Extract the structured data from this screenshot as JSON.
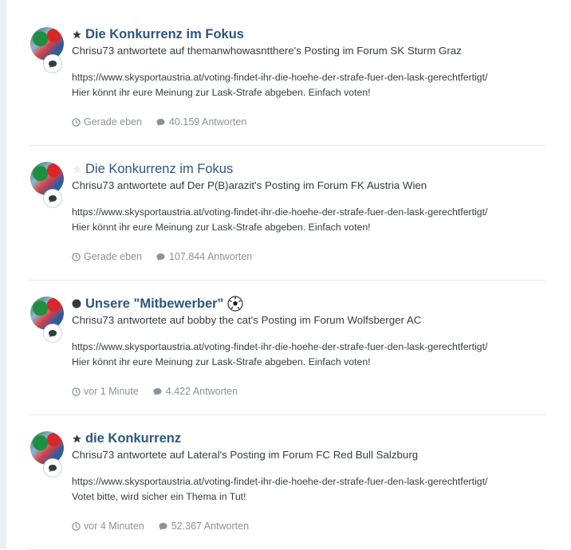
{
  "snippet_line1": "https://www.skysportaustria.at/voting-findet-ihr-die-hoehe-der-strafe-fuer-den-lask-gerechtfertigt/",
  "items": [
    {
      "title": "Die Konkurrenz im Fokus",
      "icon": "star-icon",
      "subline": "Chrisu73 antwortete auf themanwhowasntthere's Posting im Forum SK Sturm Graz",
      "snippet_line2": "Hier könnt ihr eure Meinung zur Lask-Strafe abgeben. Einfach voten!",
      "time": "Gerade eben",
      "replies": "40.159 Antworten"
    },
    {
      "title": "Die Konkurrenz im Fokus",
      "icon": "star-outline-icon",
      "subline": "Chrisu73 antwortete auf Der P(B)arazit's Posting im Forum FK Austria Wien",
      "snippet_line2": "Hier könnt ihr eure Meinung zur Lask-Strafe abgeben. Einfach voten!",
      "time": "Gerade eben",
      "replies": "107.844 Antworten"
    },
    {
      "title": "Unsere \"Mitbewerber\"",
      "icon": "unread-dot-icon",
      "subline": "Chrisu73 antwortete auf bobby the cat's Posting im Forum Wolfsberger AC",
      "snippet_line2": "Hier könnt ihr eure Meinung zur Lask-Strafe abgeben. Einfach voten!",
      "time": "vor 1 Minute",
      "replies": "4.422 Antworten"
    },
    {
      "title": "die Konkurrenz",
      "icon": "star-icon",
      "subline": "Chrisu73 antwortete auf Lateral's Posting im Forum FC Red Bull Salzburg",
      "snippet_line2": "Votet bitte, wird sicher ein Thema in Tut!",
      "time": "vor 4 Minuten",
      "replies": "52.367 Antworten"
    }
  ]
}
